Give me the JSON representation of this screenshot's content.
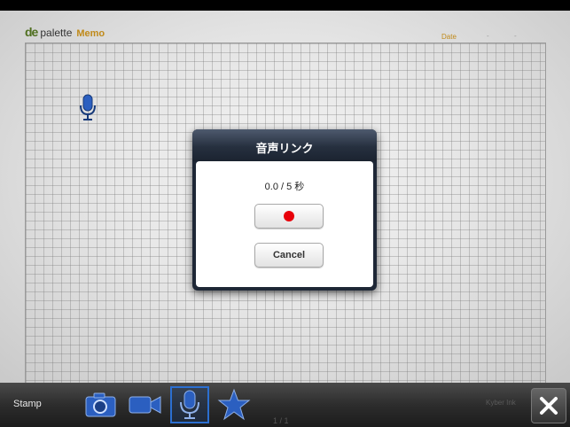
{
  "header": {
    "logo_mark": "de",
    "logo_word": "palette",
    "logo_memo": "Memo",
    "date_label": "Date",
    "date_dash": "-"
  },
  "canvas": {
    "stamp_icon": "microphone-icon"
  },
  "dialog": {
    "title": "音声リンク",
    "time_readout": "0.0 / 5 秒",
    "record_icon": "record-dot-icon",
    "cancel_label": "Cancel"
  },
  "toolbar": {
    "stamp_label": "Stamp",
    "tools": [
      "camera-icon",
      "video-camera-icon",
      "microphone-icon",
      "star-icon"
    ],
    "selected_tool": "microphone-icon",
    "page_indicator": "1 / 1",
    "watermark": "Kyber Ink",
    "close_icon": "close-icon"
  },
  "colors": {
    "accent_blue": "#2b5fc0",
    "record_red": "#e8000a",
    "logo_orange": "#c08a1a"
  }
}
